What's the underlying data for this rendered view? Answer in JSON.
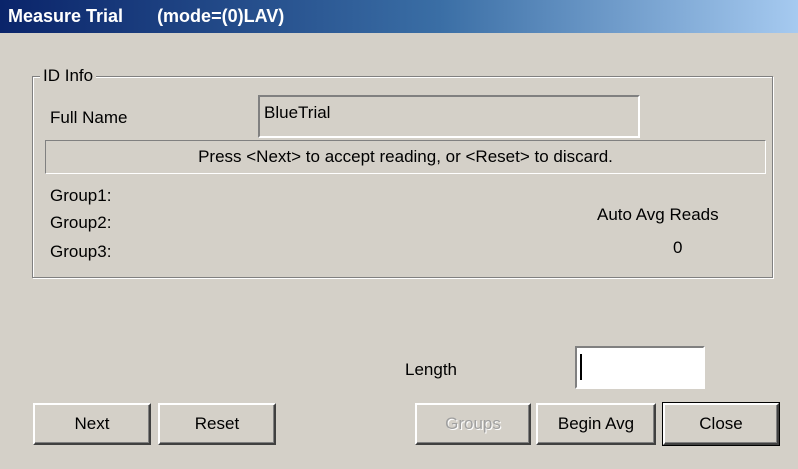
{
  "window": {
    "title": "Measure Trial",
    "mode": "(mode=(0)LAV)"
  },
  "id_info": {
    "legend": "ID Info",
    "full_name_label": "Full Name",
    "full_name_value": "BlueTrial",
    "status_message": "Press <Next> to accept reading, or <Reset> to discard.",
    "group1_label": "Group1:",
    "group2_label": "Group2:",
    "group3_label": "Group3:",
    "auto_avg_label": "Auto Avg Reads",
    "auto_avg_value": "0"
  },
  "length": {
    "label": "Length",
    "value": ""
  },
  "buttons": {
    "next": "Next",
    "reset": "Reset",
    "groups": "Groups",
    "begin_avg": "Begin Avg",
    "close": "Close"
  }
}
